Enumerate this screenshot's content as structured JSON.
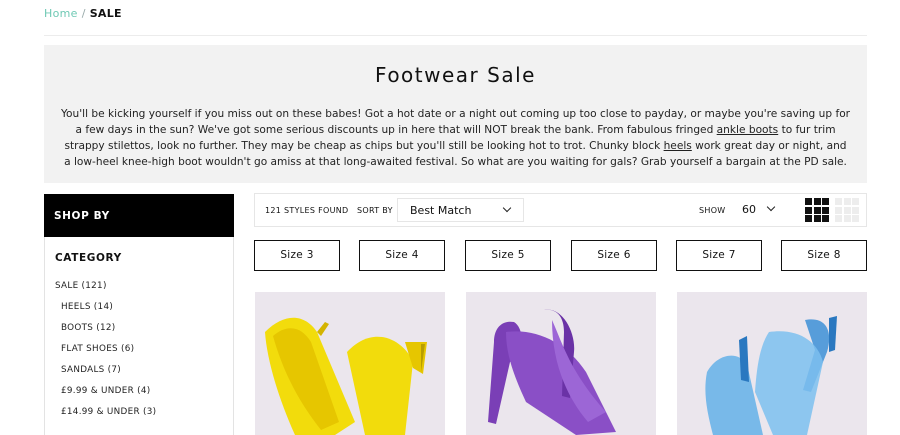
{
  "breadcrumb": {
    "home": "Home",
    "separator": "/",
    "current": "SALE"
  },
  "hero": {
    "title": "Footwear Sale",
    "desc_1": "You'll be kicking yourself if you miss out on these babes! Got a hot date or a night out coming up too close to payday, or maybe you're saving up for a few days in the sun? We've got some serious discounts up in here that will NOT break the bank. From fabulous fringed ",
    "link_ankle_boots": "ankle boots",
    "desc_2": " to fur trim strappy stilettos, look no further. They may be cheap as chips but you'll still be looking hot to trot. Chunky block ",
    "link_heels": "heels",
    "desc_3": " work great day or night, and a low-heel knee-high boot wouldn't go amiss at that long-awaited festival. So what are you waiting for gals? Grab yourself a bargain at the PD sale."
  },
  "sidebar": {
    "heading": "SHOP BY",
    "category_title": "CATEGORY",
    "items": [
      {
        "label": "SALE (121)"
      },
      {
        "label": "HEELS (14)"
      },
      {
        "label": "BOOTS (12)"
      },
      {
        "label": "FLAT SHOES (6)"
      },
      {
        "label": "SANDALS (7)"
      },
      {
        "label": "£9.99 & UNDER (4)"
      },
      {
        "label": "£14.99 & UNDER (3)"
      }
    ]
  },
  "toolbar": {
    "styles_found": "121 STYLES FOUND",
    "sort_label": "SORT BY",
    "sort_value": "Best Match",
    "show_label": "SHOW",
    "show_value": "60",
    "grid_view_icon": "grid-3x3-icon",
    "grid_view_alt_icon": "grid-4x4-icon"
  },
  "sizes": [
    "Size 3",
    "Size 4",
    "Size 5",
    "Size 6",
    "Size 7",
    "Size 8"
  ],
  "products": [
    {
      "image": "yellow-patent-pointed-stiletto-heels",
      "color": "#f2dc0c"
    },
    {
      "image": "purple-patent-pointed-stiletto-heels",
      "color": "#8a4fc6"
    },
    {
      "image": "clear-blue-perspex-pointed-stiletto-heels",
      "color": "#5aaee6"
    }
  ],
  "colors": {
    "accent": "#6fc9b4",
    "sidebar_head_bg": "#000000",
    "hero_bg": "#f2f2f2"
  }
}
